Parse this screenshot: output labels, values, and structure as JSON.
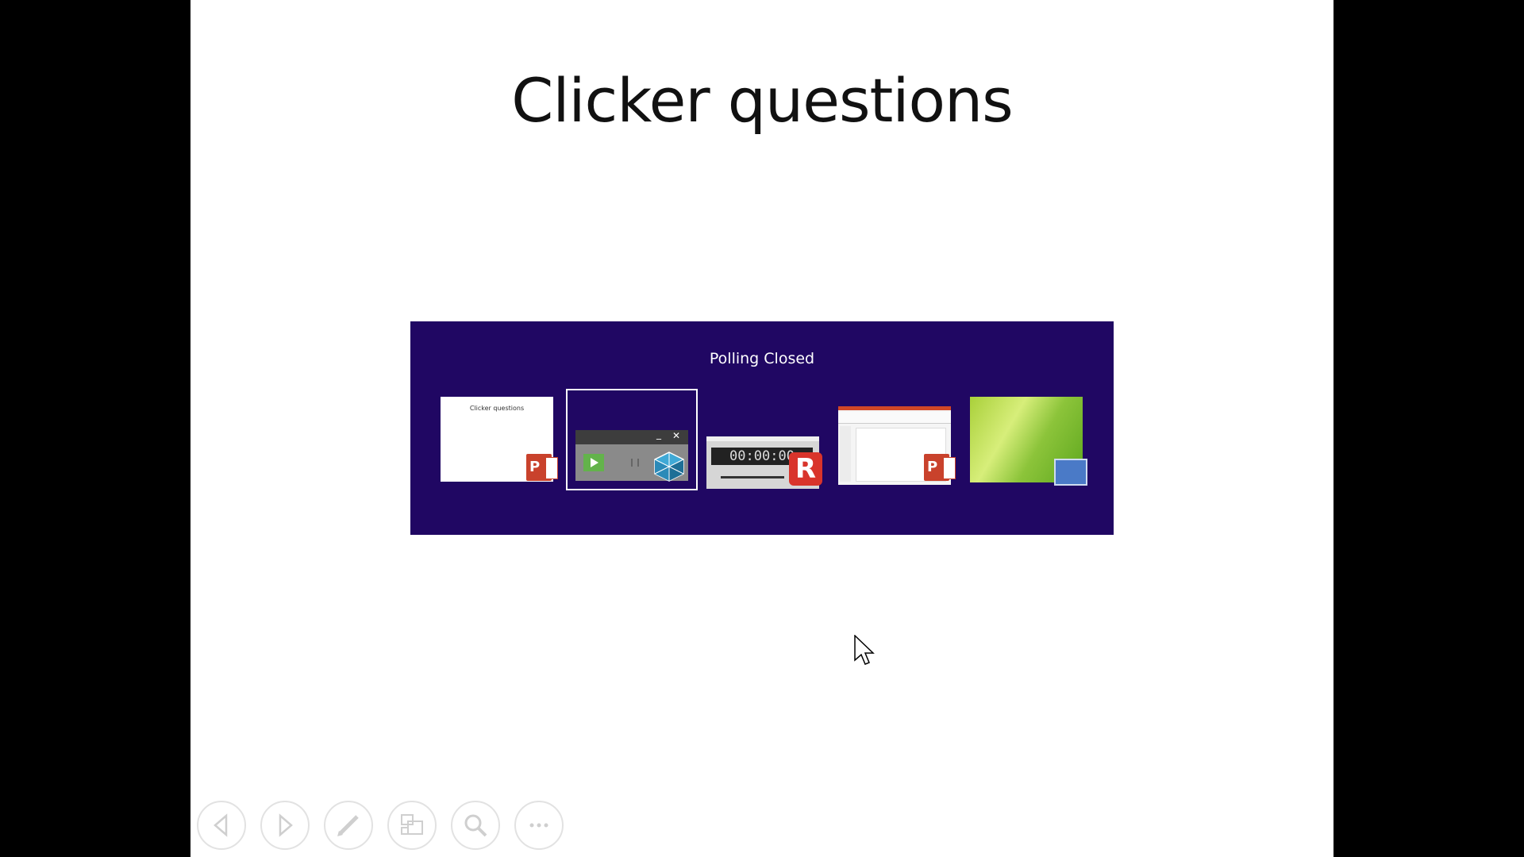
{
  "slide": {
    "title": "Clicker questions"
  },
  "switcher": {
    "title": "Polling Closed",
    "thumbnails": [
      {
        "app": "PowerPoint",
        "preview_text": "Clicker questions",
        "icon": "powerpoint-icon"
      },
      {
        "app": "Clicker polling toolbar",
        "icon": "cube-icon",
        "selected": true
      },
      {
        "app": "Recorder",
        "timer": "00:00:00",
        "icon": "r-app-icon"
      },
      {
        "app": "PowerPoint editor",
        "icon": "powerpoint-icon"
      },
      {
        "app": "Desktop",
        "icon": "monitor-icon"
      }
    ]
  },
  "toolbar": {
    "buttons": [
      "previous-slide",
      "next-slide",
      "pen",
      "see-all-slides",
      "zoom",
      "more-options"
    ],
    "more_label": "…"
  },
  "colors": {
    "switcher_bg": "#200763",
    "letterbox": "#000000"
  }
}
